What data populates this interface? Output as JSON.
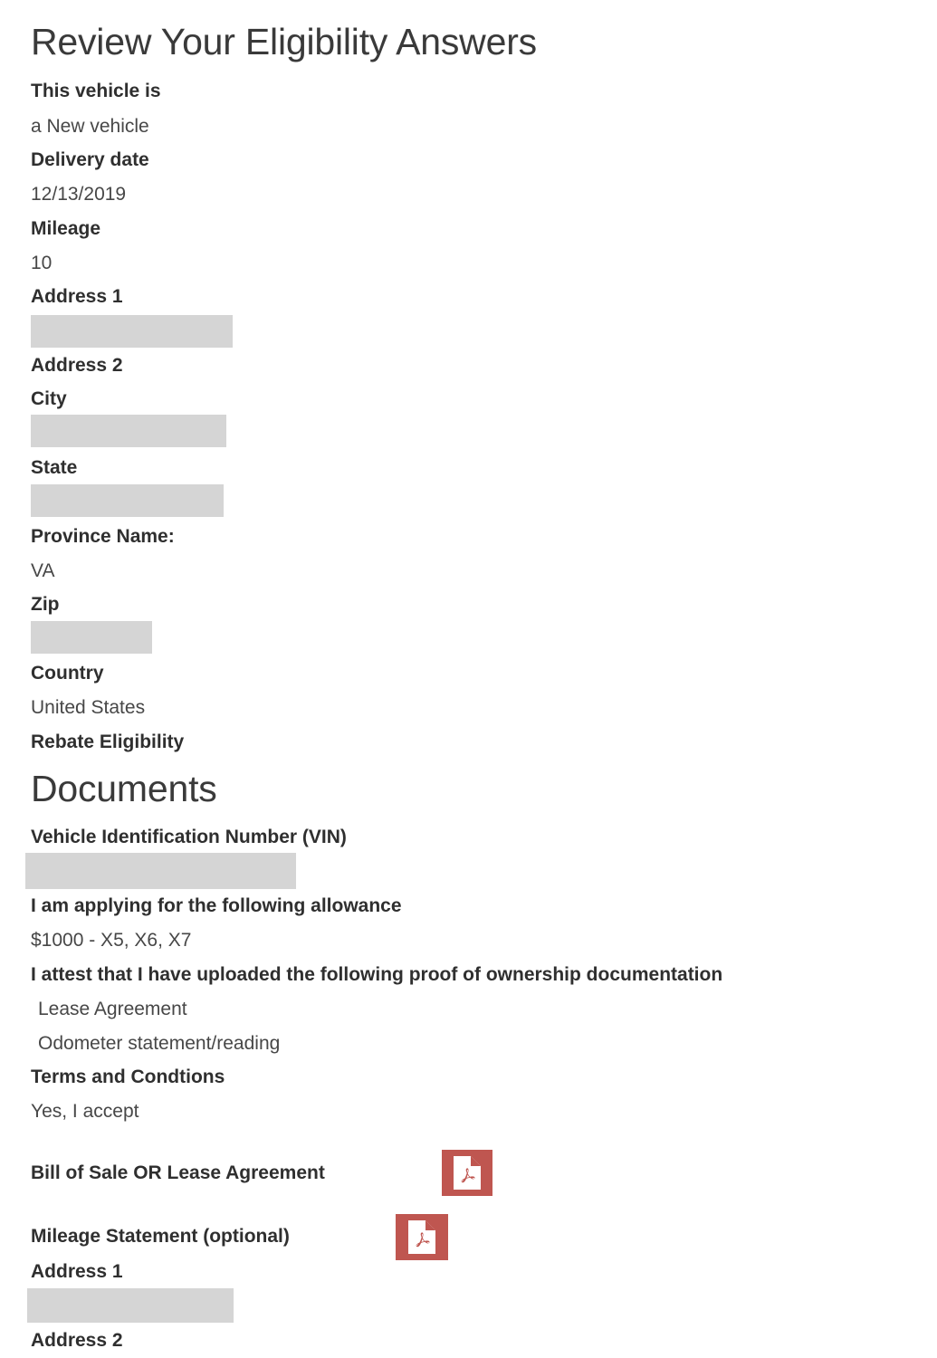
{
  "page": {
    "title": "Review Your Eligibility Answers",
    "section_heading": "Documents"
  },
  "eligibility": {
    "fields": [
      {
        "label": "This vehicle is",
        "value": "a New vehicle",
        "redacted": false
      },
      {
        "label": "Delivery date",
        "value": "12/13/2019",
        "redacted": false
      },
      {
        "label": "Mileage",
        "value": "10",
        "redacted": false
      },
      {
        "label": "Address 1",
        "value": "",
        "redacted": true
      },
      {
        "label": "Address 2",
        "value": "",
        "redacted": false
      },
      {
        "label": "City",
        "value": "",
        "redacted": true
      },
      {
        "label": "State",
        "value": "",
        "redacted": true
      },
      {
        "label": "Province Name:",
        "value": "VA",
        "redacted": false
      },
      {
        "label": "Zip",
        "value": "",
        "redacted": true
      },
      {
        "label": "Country",
        "value": "United States",
        "redacted": false
      },
      {
        "label": "Rebate Eligibility",
        "value": "",
        "redacted": false
      }
    ]
  },
  "documents": {
    "vin_label": "Vehicle Identification Number (VIN)",
    "vin_value": "",
    "allowance_label": "I am applying for the following allowance",
    "allowance_value": "$1000 - X5, X6, X7",
    "attest_label": "I attest that I have uploaded the following proof of ownership documentation",
    "attest_items": [
      "Lease Agreement",
      "Odometer statement/reading"
    ],
    "terms_label": "Terms and Condtions",
    "terms_value": "Yes, I accept",
    "uploads": [
      {
        "label": "Bill of Sale OR Lease Agreement",
        "icon": "pdf-file-icon"
      },
      {
        "label": "Mileage Statement (optional)",
        "icon": "pdf-file-icon"
      }
    ]
  },
  "address_repeat": {
    "address1_label": "Address 1",
    "address1_value": "",
    "address2_label": "Address 2"
  },
  "colors": {
    "redaction_gray": "#d5d5d5",
    "pdf_red": "#bf5650",
    "text_dark": "#2f2f2f",
    "background": "#ffffff"
  }
}
